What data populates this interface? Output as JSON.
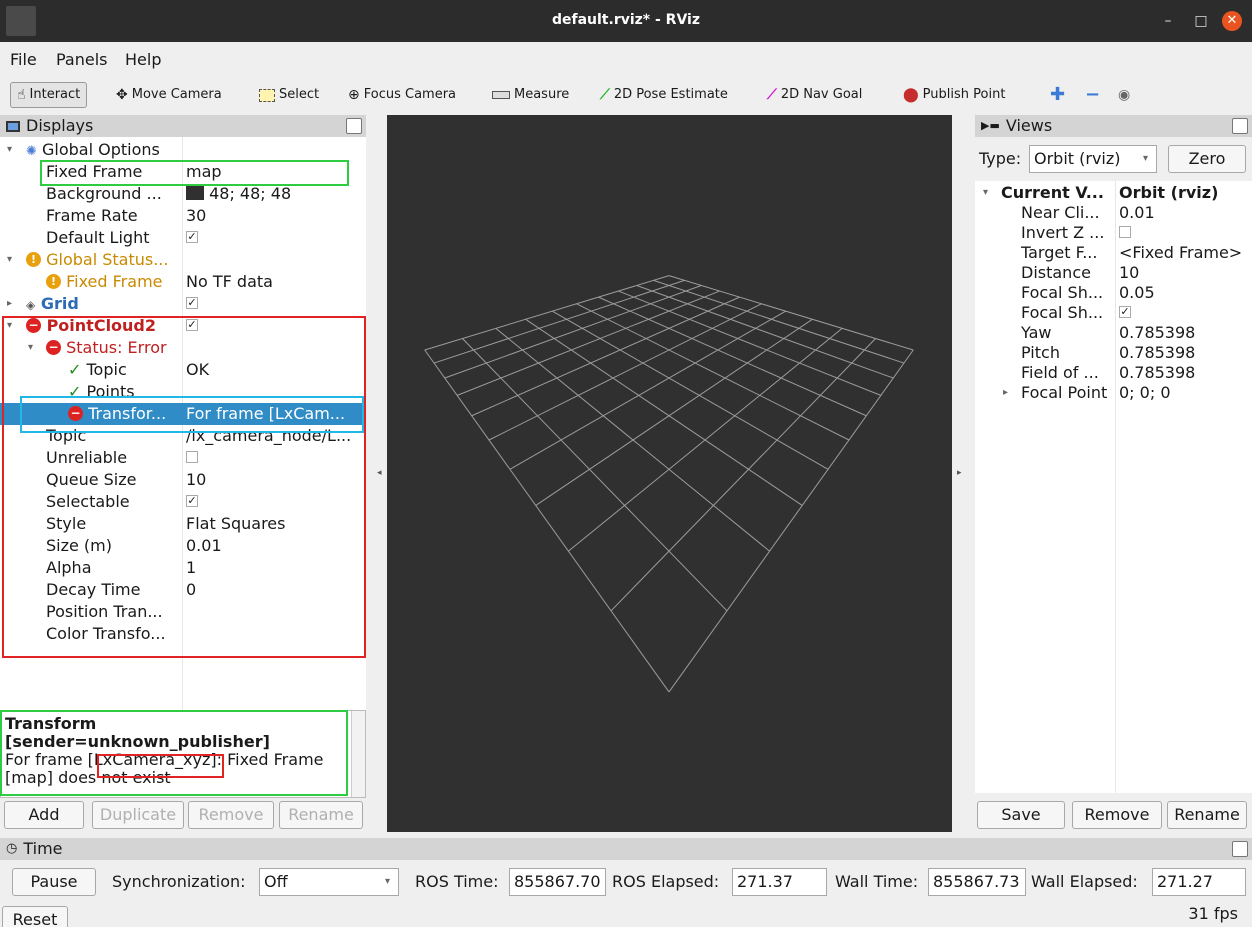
{
  "window": {
    "title": "default.rviz* - RViz",
    "min": "–",
    "max": "□",
    "close": "✕"
  },
  "menu": [
    "File",
    "Panels",
    "Help"
  ],
  "toolbar": {
    "interact": "Interact",
    "move_camera": "Move Camera",
    "select": "Select",
    "focus_camera": "Focus Camera",
    "measure": "Measure",
    "pose_estimate": "2D Pose Estimate",
    "nav_goal": "2D Nav Goal",
    "publish_point": "Publish Point"
  },
  "displays": {
    "header": "Displays",
    "rows": {
      "global_options": "Global Options",
      "fixed_frame": "Fixed Frame",
      "fixed_frame_val": "map",
      "background": "Background ...",
      "background_val": "48; 48; 48",
      "frame_rate": "Frame Rate",
      "frame_rate_val": "30",
      "default_light": "Default Light",
      "global_status": "Global Status...",
      "fixed_frame_status": "Fixed Frame",
      "fixed_frame_status_val": "No TF data",
      "grid": "Grid",
      "pointcloud2": "PointCloud2",
      "status_error": "Status: Error",
      "topic_status": "Topic",
      "topic_status_val": "OK",
      "points": "Points",
      "transform": "Transfor...",
      "transform_val": "For frame [LxCam...",
      "topic": "Topic",
      "topic_val": "/lx_camera_node/L...",
      "unreliable": "Unreliable",
      "queue_size": "Queue Size",
      "queue_size_val": "10",
      "selectable": "Selectable",
      "style": "Style",
      "style_val": "Flat Squares",
      "size": "Size (m)",
      "size_val": "0.01",
      "alpha": "Alpha",
      "alpha_val": "1",
      "decay_time": "Decay Time",
      "decay_time_val": "0",
      "position_transform": "Position Tran...",
      "color_transform": "Color Transfo..."
    },
    "description": {
      "title1": "Transform",
      "title2": "[sender=unknown_publisher]",
      "line1_a": "For frame [",
      "line1_b": "LxCamera_xyz",
      "line1_c": "]: Fixed Frame",
      "line2": "[map] does not exist"
    },
    "buttons": {
      "add": "Add",
      "duplicate": "Duplicate",
      "remove": "Remove",
      "rename": "Rename"
    }
  },
  "views": {
    "header": "Views",
    "type_label": "Type:",
    "type_value": "Orbit (rviz)",
    "zero": "Zero",
    "rows": [
      {
        "name": "Current V...",
        "value": "Orbit (rviz)"
      },
      {
        "name": "Near Cli...",
        "value": "0.01"
      },
      {
        "name": "Invert Z ...",
        "value": ""
      },
      {
        "name": "Target F...",
        "value": "<Fixed Frame>"
      },
      {
        "name": "Distance",
        "value": "10"
      },
      {
        "name": "Focal Sh...",
        "value": "0.05"
      },
      {
        "name": "Focal Sh...",
        "value": ""
      },
      {
        "name": "Yaw",
        "value": "0.785398"
      },
      {
        "name": "Pitch",
        "value": "0.785398"
      },
      {
        "name": "Field of ...",
        "value": "0.785398"
      },
      {
        "name": "Focal Point",
        "value": "0; 0; 0"
      }
    ],
    "buttons": {
      "save": "Save",
      "remove": "Remove",
      "rename": "Rename"
    }
  },
  "time": {
    "header": "Time",
    "pause": "Pause",
    "sync_label": "Synchronization:",
    "sync_value": "Off",
    "ros_time_label": "ROS Time:",
    "ros_time": "855867.70",
    "ros_elapsed_label": "ROS Elapsed:",
    "ros_elapsed": "271.37",
    "wall_time_label": "Wall Time:",
    "wall_time": "855867.73",
    "wall_elapsed_label": "Wall Elapsed:",
    "wall_elapsed": "271.27",
    "reset": "Reset",
    "fps": "31 fps"
  },
  "colors": {
    "selection": "#308cc6",
    "error": "#d22222",
    "viewport": "#303030",
    "grid": "#a0a0a0"
  }
}
